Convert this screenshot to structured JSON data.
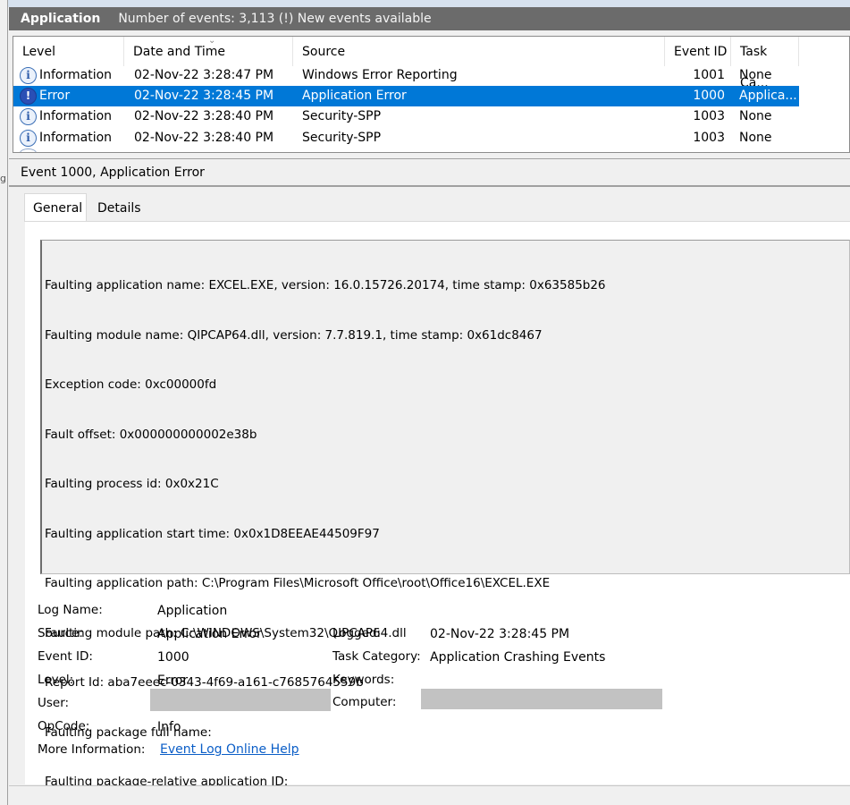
{
  "titlebar": {
    "name": "Application",
    "info": "Number of events: 3,113 (!) New events available"
  },
  "left_stub": "g",
  "columns": [
    "Level",
    "Date and Time",
    "Source",
    "Event ID",
    "Task Ca..."
  ],
  "events": [
    {
      "level": "Information",
      "icon": "info-icon",
      "date": "02-Nov-22 3:28:47 PM",
      "source": "Windows Error Reporting",
      "id": "1001",
      "task": "None",
      "selected": false
    },
    {
      "level": "Error",
      "icon": "error-icon",
      "date": "02-Nov-22 3:28:45 PM",
      "source": "Application Error",
      "id": "1000",
      "task": "Applica...",
      "selected": true
    },
    {
      "level": "Information",
      "icon": "info-icon",
      "date": "02-Nov-22 3:28:40 PM",
      "source": "Security-SPP",
      "id": "1003",
      "task": "None",
      "selected": false
    },
    {
      "level": "Information",
      "icon": "info-icon",
      "date": "02-Nov-22 3:28:40 PM",
      "source": "Security-SPP",
      "id": "1003",
      "task": "None",
      "selected": false
    }
  ],
  "detail_title": "Event 1000, Application Error",
  "tabs": {
    "general": "General",
    "details": "Details"
  },
  "description": [
    "Faulting application name: EXCEL.EXE, version: 16.0.15726.20174, time stamp: 0x63585b26",
    "Faulting module name: QIPCAP64.dll, version: 7.7.819.1, time stamp: 0x61dc8467",
    "Exception code: 0xc00000fd",
    "Fault offset: 0x000000000002e38b",
    "Faulting process id: 0x0x21C",
    "Faulting application start time: 0x0x1D8EEAE44509F97",
    "Faulting application path: C:\\Program Files\\Microsoft Office\\root\\Office16\\EXCEL.EXE",
    "Faulting module path: C:\\WINDOWS\\System32\\QIPCAP64.dll",
    "Report Id: aba7eeec-0343-4f69-a161-c7685764559b",
    "Faulting package full name: ",
    "Faulting package-relative application ID: "
  ],
  "properties": {
    "log_name_label": "Log Name:",
    "log_name": "Application",
    "source_label": "Source:",
    "source": "Application Error",
    "logged_label": "Logged:",
    "logged": "02-Nov-22 3:28:45 PM",
    "event_id_label": "Event ID:",
    "event_id": "1000",
    "task_category_label": "Task Category:",
    "task_category": "Application Crashing Events",
    "level_label": "Level:",
    "level": "Error",
    "keywords_label": "Keywords:",
    "keywords": "",
    "user_label": "User:",
    "computer_label": "Computer:",
    "opcode_label": "OpCode:",
    "opcode": "Info",
    "more_info_label": "More Information:",
    "more_info_link": "Event Log Online Help"
  }
}
